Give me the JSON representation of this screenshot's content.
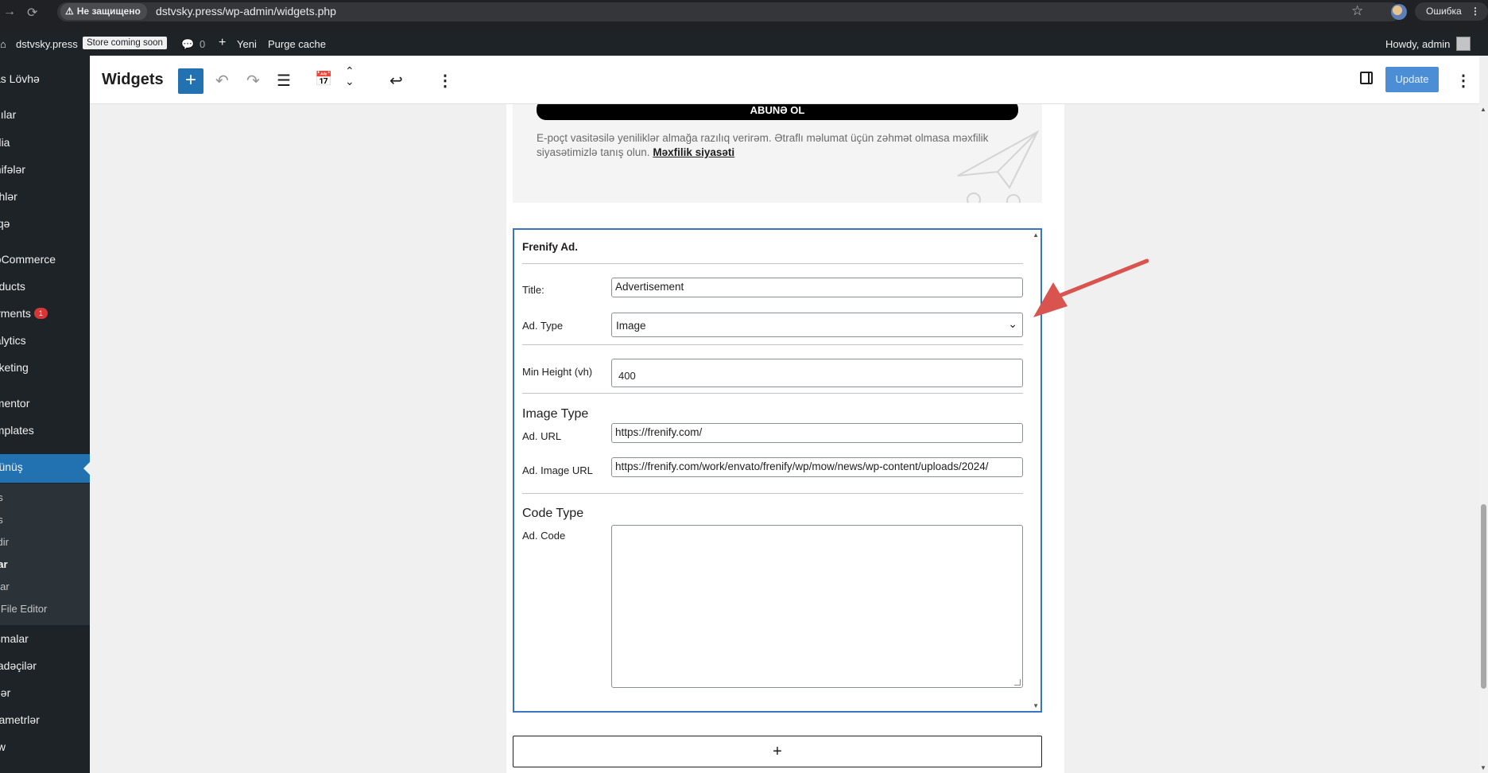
{
  "browser": {
    "security_label": "Не защищено",
    "url": "dstvsky.press/wp-admin/widgets.php",
    "error_label": "Ошибка"
  },
  "adminbar": {
    "site_name": "dstvsky.press",
    "store_badge": "Store coming soon",
    "comments_count": "0",
    "new_label": "Yeni",
    "purge_label": "Purge cache",
    "howdy": "Howdy, admin"
  },
  "sidebar": {
    "items": [
      {
        "label": "sas Lövhə"
      },
      {
        "label": "azılar"
      },
      {
        "label": "edia"
      },
      {
        "label": "əhifələr"
      },
      {
        "label": "ərhlər"
      },
      {
        "label": "laqə"
      },
      {
        "label": "ooCommerce"
      },
      {
        "label": "roducts"
      },
      {
        "label": "ayments",
        "badge": "1"
      },
      {
        "label": "nalytics"
      },
      {
        "label": "arketing"
      },
      {
        "label": "ementor"
      },
      {
        "label": "emplates"
      },
      {
        "label": "örünüş"
      },
      {
        "label": "oşmalar"
      },
      {
        "label": "tifadəçilər"
      },
      {
        "label": "ətlər"
      },
      {
        "label": "arametrlər"
      },
      {
        "label": "low"
      }
    ],
    "subitems": [
      "es",
      "ns",
      "şdir",
      "llar",
      "ular",
      "e File Editor"
    ]
  },
  "editor": {
    "title": "Widgets",
    "update_label": "Update"
  },
  "newsletter": {
    "subscribe_label": "ABUNƏ OL",
    "consent_text": "E-poçt vasitəsilə yeniliklər almağa razılıq verirəm. Ətraflı məlumat üçün zəhmət olmasa məxfilik siyasətimizlə tanış olun.",
    "privacy_link": "Məxfilik siyasəti"
  },
  "widget": {
    "name": "Frenify Ad.",
    "title_label": "Title:",
    "title_value": "Advertisement",
    "ad_type_label": "Ad. Type",
    "ad_type_value": "Image",
    "min_height_label": "Min Height (vh)",
    "min_height_value": "400",
    "image_section": "Image Type",
    "ad_url_label": "Ad. URL",
    "ad_url_value": "https://frenify.com/",
    "ad_image_url_label": "Ad. Image URL",
    "ad_image_url_value": "https://frenify.com/work/envato/frenify/wp/mow/news/wp-content/uploads/2024/",
    "code_section": "Code Type",
    "ad_code_label": "Ad. Code"
  },
  "colors": {
    "accent": "#2271b1",
    "annotation_arrow": "#d9534f",
    "widget_border": "#3a74c4"
  }
}
